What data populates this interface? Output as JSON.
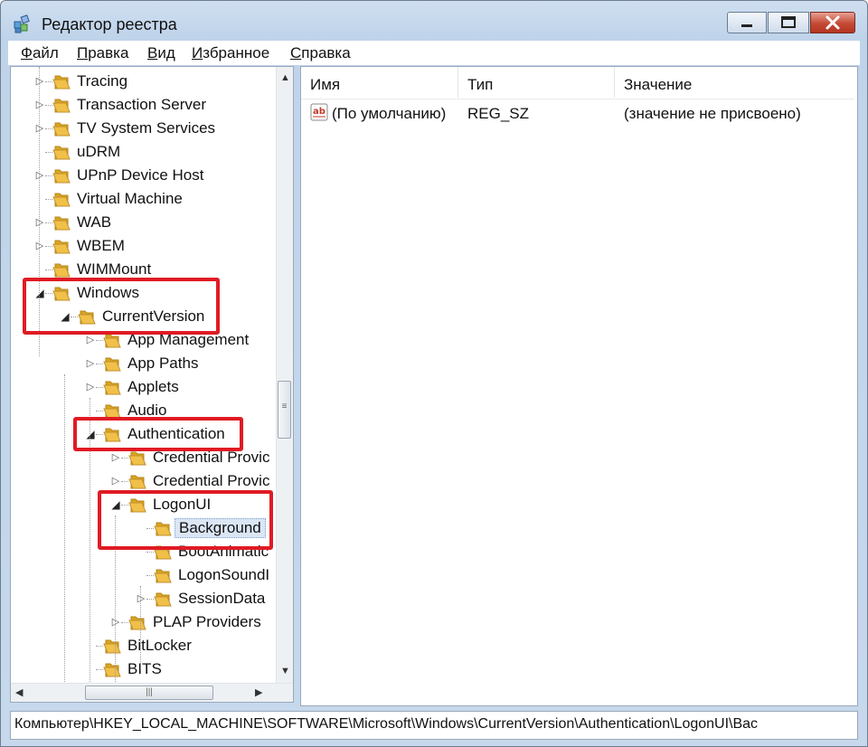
{
  "window": {
    "title": "Редактор реестра"
  },
  "menu": [
    {
      "label": "Файл",
      "accel": "Ф",
      "rest": "айл"
    },
    {
      "label": "Правка",
      "accel": "П",
      "rest": "равка"
    },
    {
      "label": "Вид",
      "accel": "В",
      "rest": "ид"
    },
    {
      "label": "Избранное",
      "accel": "И",
      "rest": "збранное"
    },
    {
      "label": "Справка",
      "accel": "С",
      "rest": "правка"
    }
  ],
  "tree": [
    {
      "label": "Tracing",
      "level": 1,
      "expander": "collapsed"
    },
    {
      "label": "Transaction Server",
      "level": 1,
      "expander": "collapsed"
    },
    {
      "label": "TV System Services",
      "level": 1,
      "expander": "collapsed"
    },
    {
      "label": "uDRM",
      "level": 1,
      "expander": "none"
    },
    {
      "label": "UPnP Device Host",
      "level": 1,
      "expander": "collapsed"
    },
    {
      "label": "Virtual Machine",
      "level": 1,
      "expander": "none"
    },
    {
      "label": "WAB",
      "level": 1,
      "expander": "collapsed"
    },
    {
      "label": "WBEM",
      "level": 1,
      "expander": "collapsed"
    },
    {
      "label": "WIMMount",
      "level": 1,
      "expander": "none"
    },
    {
      "label": "Windows",
      "level": 1,
      "expander": "expanded"
    },
    {
      "label": "CurrentVersion",
      "level": 2,
      "expander": "expanded"
    },
    {
      "label": "App Management",
      "level": 3,
      "expander": "collapsed"
    },
    {
      "label": "App Paths",
      "level": 3,
      "expander": "collapsed"
    },
    {
      "label": "Applets",
      "level": 3,
      "expander": "collapsed"
    },
    {
      "label": "Audio",
      "level": 3,
      "expander": "none"
    },
    {
      "label": "Authentication",
      "level": 3,
      "expander": "expanded"
    },
    {
      "label": "Credential Provic",
      "level": 4,
      "expander": "collapsed"
    },
    {
      "label": "Credential Provic",
      "level": 4,
      "expander": "collapsed"
    },
    {
      "label": "LogonUI",
      "level": 4,
      "expander": "expanded"
    },
    {
      "label": "Background",
      "level": 5,
      "expander": "none",
      "selected": true
    },
    {
      "label": "BootAnimatic",
      "level": 5,
      "expander": "none"
    },
    {
      "label": "LogonSoundI",
      "level": 5,
      "expander": "none"
    },
    {
      "label": "SessionData",
      "level": 5,
      "expander": "collapsed"
    },
    {
      "label": "PLAP Providers",
      "level": 4,
      "expander": "collapsed"
    },
    {
      "label": "BitLocker",
      "level": 3,
      "expander": "none"
    },
    {
      "label": "BITS",
      "level": 3,
      "expander": "none"
    }
  ],
  "list": {
    "columns": [
      "Имя",
      "Тип",
      "Значение"
    ],
    "rows": [
      {
        "icon": "string-value-icon",
        "name": "(По умолчанию)",
        "type": "REG_SZ",
        "value": "(значение не присвоено)"
      }
    ]
  },
  "status": "Компьютер\\HKEY_LOCAL_MACHINE\\SOFTWARE\\Microsoft\\Windows\\CurrentVersion\\Authentication\\LogonUI\\Bac",
  "colors": {
    "highlight": "#e01b24",
    "folder": "#f0c048",
    "titlebar": "#c7d8ec",
    "close": "#c44a34"
  }
}
